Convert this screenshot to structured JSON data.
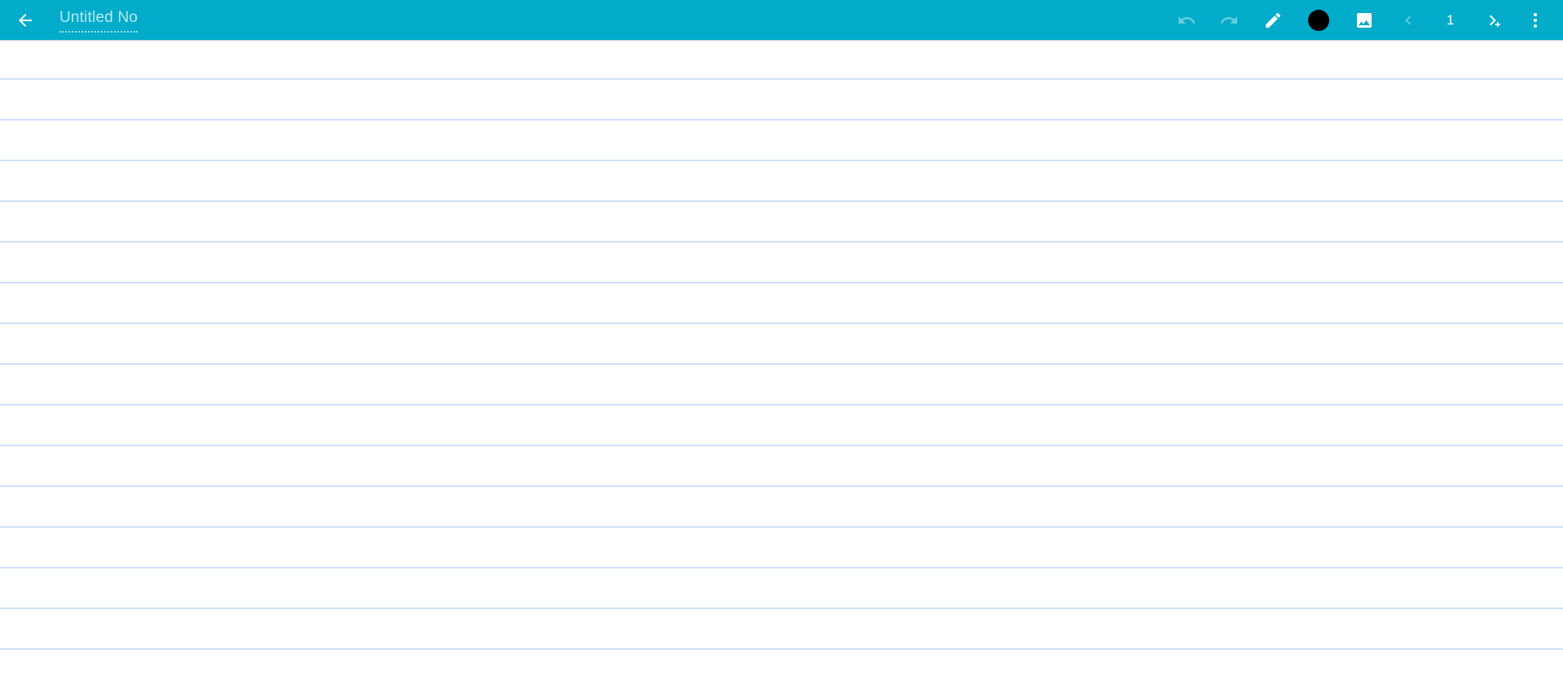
{
  "app": {
    "accent_color": "#00ACC9",
    "canvas_background": "#ffffff",
    "rule_line_color": "#cfe0fb",
    "ink_color": "#000000"
  },
  "appbar": {
    "back_label": "Back",
    "back_icon": "arrow-left-icon",
    "title": {
      "value": "",
      "placeholder": "Untitled Note"
    },
    "tools": [
      {
        "id": "undo",
        "label": "Undo",
        "icon": "undo-icon",
        "enabled": false
      },
      {
        "id": "redo",
        "label": "Redo",
        "icon": "redo-icon",
        "enabled": false
      },
      {
        "id": "pen",
        "label": "Pen",
        "icon": "pencil-icon",
        "enabled": true
      },
      {
        "id": "color",
        "label": "Color",
        "icon": "color-swatch-icon",
        "enabled": true,
        "color": "#000000"
      },
      {
        "id": "image",
        "label": "Insert image",
        "icon": "image-icon",
        "enabled": true
      },
      {
        "id": "prev_page",
        "label": "Previous page",
        "icon": "chevron-left-icon",
        "enabled": false
      },
      {
        "id": "page_num",
        "label": "Page number",
        "value": "1",
        "enabled": true
      },
      {
        "id": "add_page",
        "label": "Add page",
        "icon": "chevron-right-plus-icon",
        "enabled": true
      },
      {
        "id": "overflow",
        "label": "More options",
        "icon": "more-vert-icon",
        "enabled": true
      }
    ]
  },
  "canvas": {
    "label": "Note drawing area",
    "content": "",
    "line_spacing_px": 50,
    "line_count": 17
  }
}
